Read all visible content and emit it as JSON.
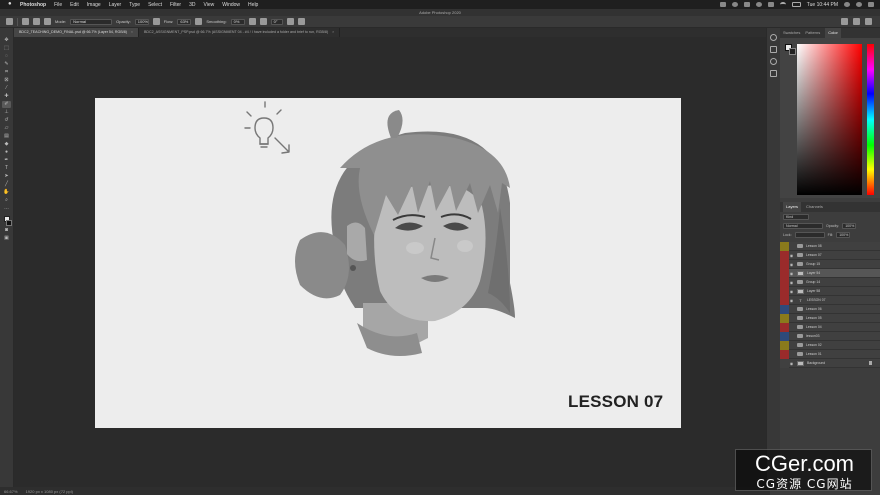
{
  "menubar": {
    "items": [
      "Photoshop",
      "File",
      "Edit",
      "Image",
      "Layer",
      "Type",
      "Select",
      "Filter",
      "3D",
      "View",
      "Window",
      "Help"
    ],
    "clock": "Tue 10:44 PM"
  },
  "window": {
    "title": "Adobe Photoshop 2020"
  },
  "options": {
    "mode_label": "Mode:",
    "mode_value": "Normal",
    "opacity_label": "Opacity:",
    "opacity_value": "100%",
    "flow_label": "Flow:",
    "flow_value": "63%",
    "smoothing_label": "Smoothing:",
    "smoothing_value": "0%",
    "angle_value": "0°"
  },
  "tabs": [
    {
      "label": "BDC2_TEACHING_DEMO_FINAL.psd @ 66.7% (Layer 54, RGB/8)",
      "close": "×"
    },
    {
      "label": "BDC2_ASSIGNMENT_PSP.psd @ 66.7% (ASSIGNMENT 04 - #4 / I have included a folder and brief to run, RGB/8)",
      "close": "×"
    }
  ],
  "canvas": {
    "lesson_title": "LESSON 07"
  },
  "status": {
    "zoom": "66.67%",
    "doc_info": "1920 px x 1080 px (72 ppi)"
  },
  "color_panel": {
    "tabs": [
      "Swatches",
      "Patterns",
      "Color"
    ],
    "active": "Color"
  },
  "layers_panel": {
    "tabs": [
      "Layers",
      "Channels"
    ],
    "kind_label": "Kind",
    "blend_mode": "Normal",
    "opacity_label": "Opacity:",
    "opacity_value": "100%",
    "lock_label": "Lock:",
    "fill_label": "Fill:",
    "fill_value": "100%",
    "layers": [
      {
        "name": "Lesson 08",
        "type": "folder",
        "color": "#8a7a1c",
        "visible": false,
        "selected": false
      },
      {
        "name": "Lesson 07",
        "type": "folder",
        "color": "#9a2b2b",
        "visible": true,
        "selected": false
      },
      {
        "name": "Group 15",
        "type": "folder",
        "color": "#9a2b2b",
        "visible": true,
        "selected": false
      },
      {
        "name": "Layer 54",
        "type": "pixel",
        "color": "#9a2b2b",
        "visible": true,
        "selected": true
      },
      {
        "name": "Group 14",
        "type": "folder",
        "color": "#9a2b2b",
        "visible": true,
        "selected": false
      },
      {
        "name": "Layer 58",
        "type": "pixel",
        "color": "#9a2b2b",
        "visible": true,
        "selected": false
      },
      {
        "name": "LESSON 07",
        "type": "text",
        "color": "#9a2b2b",
        "visible": true,
        "selected": false
      },
      {
        "name": "Lesson 06",
        "type": "folder",
        "color": "#2f4a7a",
        "visible": false,
        "selected": false
      },
      {
        "name": "Lesson 05",
        "type": "folder",
        "color": "#8a7a1c",
        "visible": false,
        "selected": false
      },
      {
        "name": "Lesson 04",
        "type": "folder",
        "color": "#9a2b2b",
        "visible": false,
        "selected": false
      },
      {
        "name": "lesson03",
        "type": "folder",
        "color": "#2f4a7a",
        "visible": false,
        "selected": false
      },
      {
        "name": "Lesson 02",
        "type": "folder",
        "color": "#8a7a1c",
        "visible": false,
        "selected": false
      },
      {
        "name": "Lesson 01",
        "type": "folder",
        "color": "#9a2b2b",
        "visible": false,
        "selected": false
      },
      {
        "name": "Background",
        "type": "pixel",
        "color": "#404040",
        "visible": true,
        "selected": false
      }
    ]
  },
  "watermark": {
    "title": "CGer.com",
    "subtitle": "CG资源 CG网站"
  }
}
